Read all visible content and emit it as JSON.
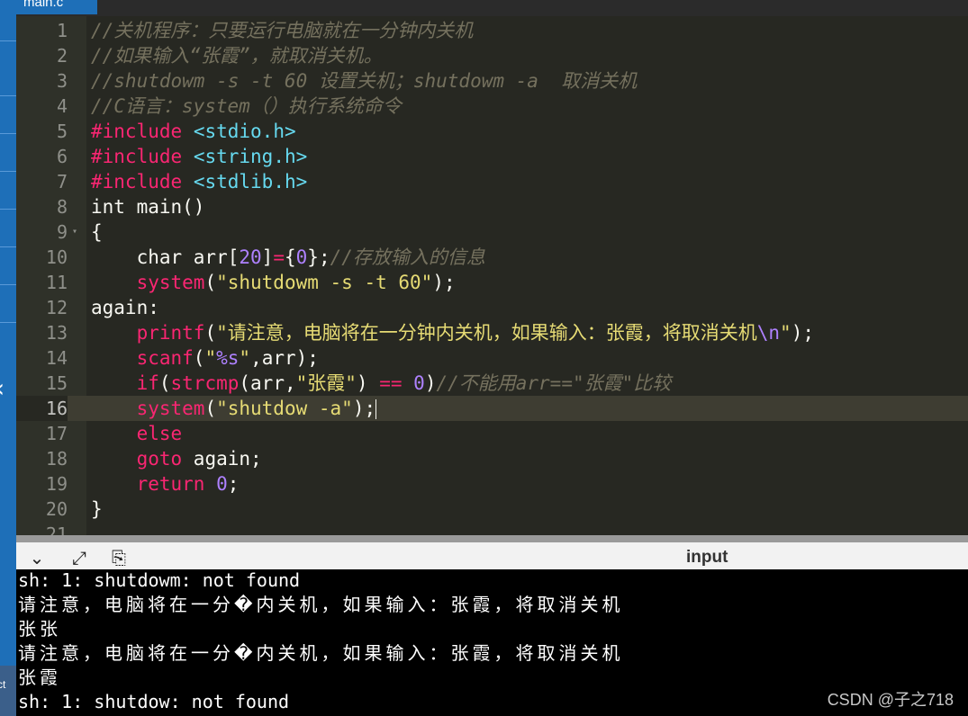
{
  "tab": {
    "filename": "main.c"
  },
  "editor": {
    "lines": [
      {
        "n": "1",
        "tokens": [
          {
            "c": "c",
            "t": "//关机程序：只要运行电脑就在一分钟内关机"
          }
        ]
      },
      {
        "n": "2",
        "tokens": [
          {
            "c": "c",
            "t": "//如果输入“张霞”，就取消关机。"
          }
        ]
      },
      {
        "n": "3",
        "tokens": [
          {
            "c": "c",
            "t": "//shutdowm -s -t 60 设置关机；shutdowm -a  取消关机"
          }
        ]
      },
      {
        "n": "4",
        "tokens": [
          {
            "c": "c",
            "t": "//C语言：system（）执行系统命令"
          }
        ]
      },
      {
        "n": "5",
        "tokens": [
          {
            "c": "inc",
            "t": "#include"
          },
          {
            "c": "t",
            "t": " "
          },
          {
            "c": "hdr",
            "t": "<stdio.h>"
          }
        ]
      },
      {
        "n": "6",
        "tokens": [
          {
            "c": "inc",
            "t": "#include"
          },
          {
            "c": "t",
            "t": " "
          },
          {
            "c": "hdr",
            "t": "<string.h>"
          }
        ]
      },
      {
        "n": "7",
        "tokens": [
          {
            "c": "inc",
            "t": "#include"
          },
          {
            "c": "t",
            "t": " "
          },
          {
            "c": "hdr",
            "t": "<stdlib.h>"
          }
        ]
      },
      {
        "n": "8",
        "tokens": [
          {
            "c": "t",
            "t": "int main()"
          }
        ]
      },
      {
        "n": "9",
        "fold": true,
        "tokens": [
          {
            "c": "t",
            "t": "{"
          }
        ]
      },
      {
        "n": "10",
        "tokens": [
          {
            "c": "t",
            "t": "    char arr["
          },
          {
            "c": "num",
            "t": "20"
          },
          {
            "c": "t",
            "t": "]"
          },
          {
            "c": "op",
            "t": "="
          },
          {
            "c": "t",
            "t": "{"
          },
          {
            "c": "num",
            "t": "0"
          },
          {
            "c": "t",
            "t": "};"
          },
          {
            "c": "c",
            "t": "//存放输入的信息"
          }
        ]
      },
      {
        "n": "11",
        "tokens": [
          {
            "c": "t",
            "t": "    "
          },
          {
            "c": "fn",
            "t": "system"
          },
          {
            "c": "t",
            "t": "("
          },
          {
            "c": "str",
            "t": "\"shutdowm -s -t 60\""
          },
          {
            "c": "t",
            "t": ");"
          }
        ]
      },
      {
        "n": "12",
        "tokens": [
          {
            "c": "t",
            "t": "again:"
          }
        ]
      },
      {
        "n": "13",
        "tokens": [
          {
            "c": "t",
            "t": "    "
          },
          {
            "c": "fn",
            "t": "printf"
          },
          {
            "c": "t",
            "t": "("
          },
          {
            "c": "str",
            "t": "\"请注意，电脑将在一分钟内关机，如果输入：张霞，将取消关机"
          },
          {
            "c": "esc",
            "t": "\\n"
          },
          {
            "c": "str",
            "t": "\""
          },
          {
            "c": "t",
            "t": ");"
          }
        ]
      },
      {
        "n": "14",
        "tokens": [
          {
            "c": "t",
            "t": "    "
          },
          {
            "c": "fn",
            "t": "scanf"
          },
          {
            "c": "t",
            "t": "("
          },
          {
            "c": "str",
            "t": "\""
          },
          {
            "c": "esc",
            "t": "%s"
          },
          {
            "c": "str",
            "t": "\""
          },
          {
            "c": "t",
            "t": ",arr);"
          }
        ]
      },
      {
        "n": "15",
        "tokens": [
          {
            "c": "t",
            "t": "    "
          },
          {
            "c": "kw",
            "t": "if"
          },
          {
            "c": "t",
            "t": "("
          },
          {
            "c": "fn",
            "t": "strcmp"
          },
          {
            "c": "t",
            "t": "(arr,"
          },
          {
            "c": "str",
            "t": "\"张霞\""
          },
          {
            "c": "t",
            "t": ") "
          },
          {
            "c": "op",
            "t": "=="
          },
          {
            "c": "t",
            "t": " "
          },
          {
            "c": "num",
            "t": "0"
          },
          {
            "c": "t",
            "t": ")"
          },
          {
            "c": "c",
            "t": "//不能用arr==\"张霞\"比较"
          }
        ]
      },
      {
        "n": "16",
        "active": true,
        "cursor": true,
        "tokens": [
          {
            "c": "t",
            "t": "    "
          },
          {
            "c": "fn",
            "t": "system"
          },
          {
            "c": "t",
            "t": "("
          },
          {
            "c": "str",
            "t": "\"shutdow -a\""
          },
          {
            "c": "t",
            "t": ");"
          }
        ]
      },
      {
        "n": "17",
        "tokens": [
          {
            "c": "t",
            "t": "    "
          },
          {
            "c": "kw",
            "t": "else"
          }
        ]
      },
      {
        "n": "18",
        "tokens": [
          {
            "c": "t",
            "t": "    "
          },
          {
            "c": "kw",
            "t": "goto"
          },
          {
            "c": "t",
            "t": " again;"
          }
        ]
      },
      {
        "n": "19",
        "tokens": [
          {
            "c": "t",
            "t": "    "
          },
          {
            "c": "kw",
            "t": "return"
          },
          {
            "c": "t",
            "t": " "
          },
          {
            "c": "num",
            "t": "0"
          },
          {
            "c": "t",
            "t": ";"
          }
        ]
      },
      {
        "n": "20",
        "tokens": [
          {
            "c": "t",
            "t": "}"
          }
        ]
      },
      {
        "n": "21",
        "tokens": []
      }
    ]
  },
  "panel": {
    "title": "input",
    "collapse_icon": "chevron-down-icon",
    "expand_icon": "expand-arrows-icon",
    "clear_icon": "clipboard-person-icon"
  },
  "terminal": {
    "lines": [
      {
        "text": "sh: 1: shutdowm: not found",
        "zh": false
      },
      {
        "text": "请注意，电脑将在一分�内关机，如果输入：张霞，将取消关机",
        "zh": true
      },
      {
        "text": "张张",
        "zh": true
      },
      {
        "text": "请注意，电脑将在一分�内关机，如果输入：张霞，将取消关机",
        "zh": true
      },
      {
        "text": "张霞",
        "zh": true
      },
      {
        "text": "sh: 1: shutdow: not found",
        "zh": false
      }
    ]
  },
  "watermark": "CSDN @子之718",
  "left_strip": {
    "bottom_label": "ct",
    "arrow": "chevron-left-icon"
  }
}
